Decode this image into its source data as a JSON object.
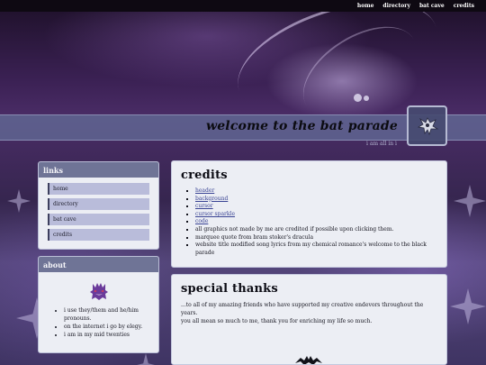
{
  "nav": {
    "items": [
      "home",
      "directory",
      "bat cave",
      "credits"
    ]
  },
  "banner": {
    "title": "welcome to the bat parade",
    "subtitle": "i am all in i"
  },
  "sidebar": {
    "links": {
      "heading": "links",
      "items": [
        "home",
        "directory",
        "bat cave",
        "credits"
      ]
    },
    "about": {
      "heading": "about",
      "items": [
        "i use they/them and he/him pronouns.",
        "on the internet i go by elegy.",
        "i am in my mid twenties"
      ]
    }
  },
  "credits": {
    "heading": "credits",
    "links": [
      "header",
      "background",
      "cursor",
      "cursor sparkle",
      "code"
    ],
    "notes": [
      "all graphics not made by me are credited if possible upon clicking them.",
      "marquee quote from bram stoker's dracula",
      "website title modified song lyrics from my chemical romance's welcome to the black parade"
    ]
  },
  "thanks": {
    "heading": "special thanks",
    "line1": "...to all of my amazing friends who have supported my creative endevors throughout the years.",
    "line2": "you all mean so much to me, thank you for enriching my life so much."
  },
  "colors": {
    "nav_bg": "#0e0912",
    "banner_bg": "#6068a0",
    "panel_bg": "#eceef4",
    "panel_head": "#6f7496",
    "link_bg": "#b9bcda",
    "link_text": "#3a4494"
  },
  "icons": [
    "bat-avatar-icon",
    "gengar-icon",
    "bat-silhouette-icon"
  ]
}
